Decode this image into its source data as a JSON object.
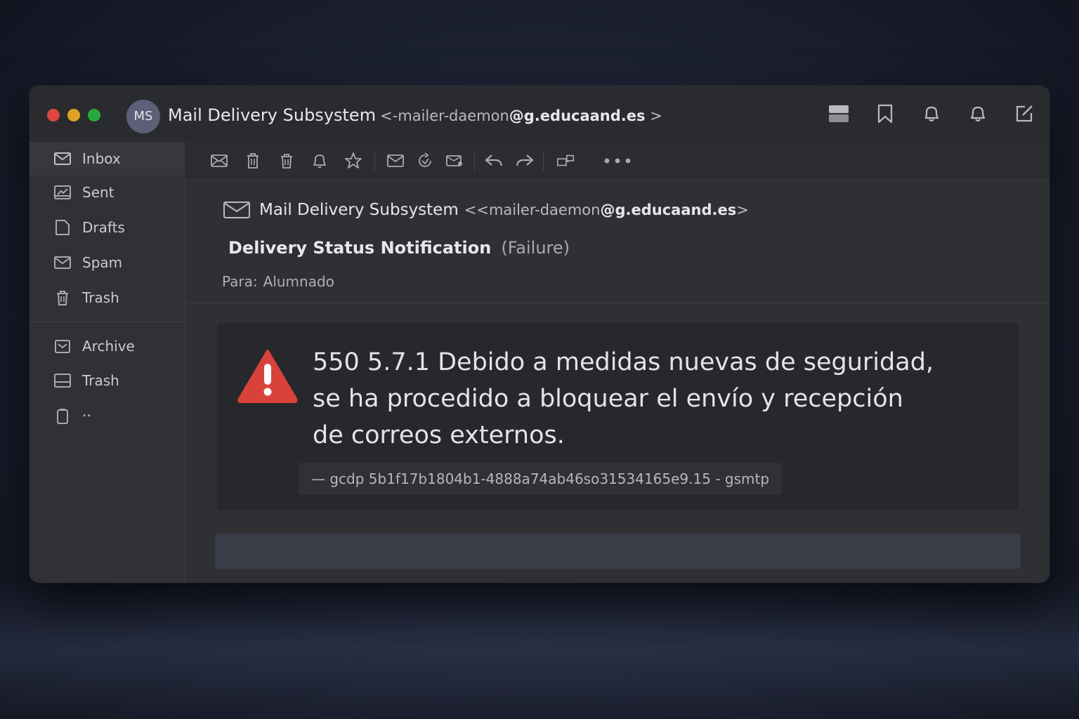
{
  "window": {
    "avatar_initials": "MS",
    "title_sender": "Mail Delivery Subsystem",
    "title_addr_prefix": "<-mailer-daemon",
    "title_addr_domain": "@g.educaand.es",
    "title_addr_suffix": " >"
  },
  "top_icons": [
    "layout-icon",
    "bookmark-icon",
    "bell-icon",
    "notification-icon",
    "compose-icon"
  ],
  "sidebar": {
    "items": [
      {
        "label": "Inbox",
        "icon": "inbox-icon"
      },
      {
        "label": "Sent",
        "icon": "sent-icon"
      },
      {
        "label": "Drafts",
        "icon": "drafts-icon"
      },
      {
        "label": "Spam",
        "icon": "spam-icon"
      },
      {
        "label": "Trash",
        "icon": "trash-icon"
      },
      {
        "label": "Archive",
        "icon": "archive-icon"
      },
      {
        "label": "Trash",
        "icon": "trash-tray-icon"
      },
      {
        "label": "··",
        "icon": "clipboard-icon"
      }
    ]
  },
  "toolbar": {
    "icons": [
      "mail-icon",
      "delete-icon",
      "trash-icon",
      "bell-icon",
      "star-icon",
      "envelope-icon",
      "refresh-icon",
      "tag-icon",
      "reply-icon",
      "forward-icon",
      "move-icon",
      "more-icon"
    ]
  },
  "message": {
    "from_name": "Mail Delivery Subsystem",
    "from_addr_prefix": "<<mailer-daemon",
    "from_addr_domain": "@g.educaand.es",
    "from_addr_suffix": ">",
    "subject": "Delivery Status Notification",
    "subject_tag": "(Failure)",
    "to_label": "Para:",
    "to_value": "Alumnado",
    "error_line1": "550 5.7.1 Debido a medidas nuevas de seguridad,",
    "error_line2": "se ha procedido a bloquear el envío y recepción",
    "error_line3": "de correos externos.",
    "error_code": "— gcdp  5b1f17b1804b1-4888a74ab46so31534165e9.15 - gsmtp"
  },
  "colors": {
    "warning": "#d8423a",
    "accent_red": "#e0443e",
    "accent_yellow": "#dfa125",
    "accent_green": "#27aa3d"
  }
}
